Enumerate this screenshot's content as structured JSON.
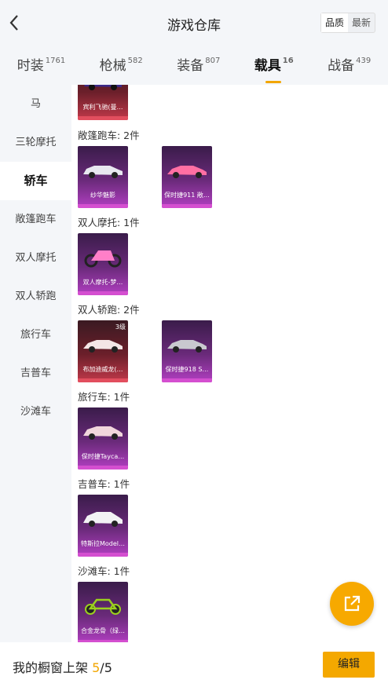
{
  "header": {
    "title": "游戏仓库",
    "sort_quality": "品质",
    "sort_newest": "最新"
  },
  "tabs": [
    {
      "label": "时装",
      "count": "1761"
    },
    {
      "label": "枪械",
      "count": "582"
    },
    {
      "label": "装备",
      "count": "807"
    },
    {
      "label": "载具",
      "count": "16"
    },
    {
      "label": "战备",
      "count": "439"
    }
  ],
  "sidebar": {
    "items": [
      {
        "label": "马"
      },
      {
        "label": "三轮摩托"
      },
      {
        "label": "轿车"
      },
      {
        "label": "敞篷跑车"
      },
      {
        "label": "双人摩托"
      },
      {
        "label": "双人轿跑"
      },
      {
        "label": "旅行车"
      },
      {
        "label": "吉普车"
      },
      {
        "label": "沙滩车"
      }
    ]
  },
  "sections": [
    {
      "title": "敞篷跑车: 2件"
    },
    {
      "title": "双人摩托: 1件"
    },
    {
      "title": "双人轿跑: 2件"
    },
    {
      "title": "旅行车: 1件"
    },
    {
      "title": "吉普车: 1件"
    },
    {
      "title": "沙滩车: 1件"
    }
  ],
  "cards": [
    {
      "name": "宾利飞驰(曼…"
    },
    {
      "name": "纱华魅影"
    },
    {
      "name": "保时捷911 敞…"
    },
    {
      "name": "双人摩托-梦…"
    },
    {
      "name": "布加迪威龙(…",
      "level": "3级"
    },
    {
      "name": "保时捷918 S…"
    },
    {
      "name": "保时捷Tayca…"
    },
    {
      "name": "特斯拉Model…"
    },
    {
      "name": "合金龙骨（绿…"
    }
  ],
  "footer": {
    "text": "我的橱窗上架",
    "count": "5",
    "total": "/5",
    "edit_label": "编辑"
  },
  "colors": {
    "accent": "#f4a800",
    "card_purple": "#b23fc2",
    "card_red": "#c2394a"
  }
}
